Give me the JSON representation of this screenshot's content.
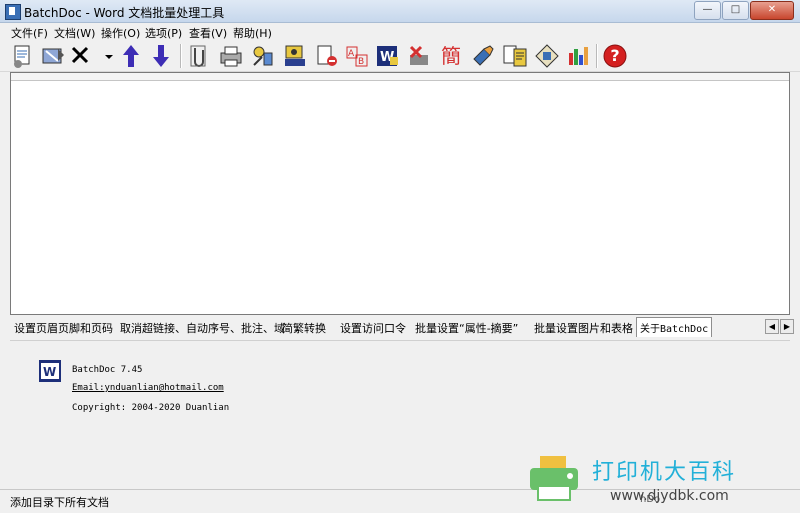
{
  "window": {
    "title": "BatchDoc - Word 文档批量处理工具",
    "buttons": {
      "minimize": "—",
      "maximize": "□",
      "close": "✕"
    }
  },
  "menu": [
    "文件(F)",
    "文档(W)",
    "操作(O)",
    "选项(P)",
    "查看(V)",
    "帮助(H)"
  ],
  "toolbar": [
    "add-file-icon",
    "add-folder-icon",
    "delete-icon",
    "dropdown-arrow-icon",
    "move-up-icon",
    "move-down-icon",
    "attach-icon",
    "print-icon",
    "wrench-icon",
    "rename-icon",
    "remove-page-icon",
    "replace-icon",
    "word-icon",
    "stop-icon",
    "traditional-chinese-icon",
    "paint-icon",
    "notes-icon",
    "convert-icon",
    "chart-icon",
    "help-icon"
  ],
  "toolbar_labels": {
    "traditional": "簡",
    "help": "?"
  },
  "tabs": [
    "设置页眉页脚和页码",
    "取消超链接、自动序号、批注、域",
    "简繁转换",
    "设置访问口令",
    "批量设置“属性-摘要”",
    "批量设置图片和表格",
    "关于BatchDoc"
  ],
  "tab_scroll": {
    "left": "◀",
    "right": "▶"
  },
  "about": {
    "version": "BatchDoc 7.45",
    "email": "Email:ynduanlian@hotmail.com",
    "copyright": "Copyright: 2004-2020 Duanlian"
  },
  "status": {
    "text": "添加目录下所有文档",
    "right": "hDo"
  },
  "watermark": {
    "text": "打印机大百科",
    "url": "www.djydbk.com"
  }
}
